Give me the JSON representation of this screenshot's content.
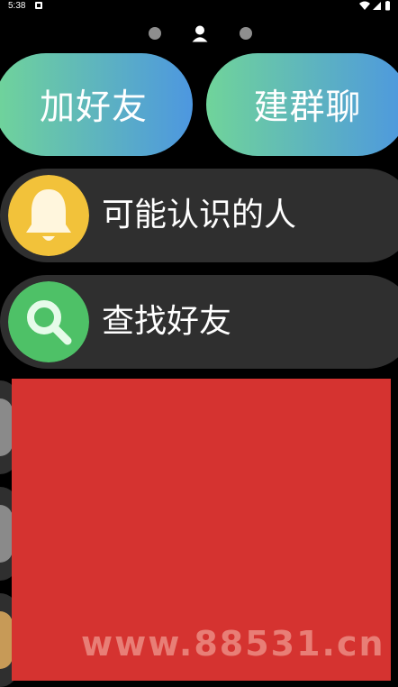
{
  "status_bar": {
    "time": "5:38"
  },
  "actions": {
    "add_friend_label": "加好友",
    "create_group_label": "建群聊"
  },
  "list": {
    "items": [
      {
        "label": "可能认识的人",
        "icon": "bell-icon"
      },
      {
        "label": "查找好友",
        "icon": "search-icon"
      }
    ]
  },
  "watermark": "www.88531.cn",
  "colors": {
    "background": "#000000",
    "row_background": "#2f2f2f",
    "gradient_start": "#70d49a",
    "gradient_end": "#4d97e0",
    "bell_icon_bg": "#f2c23a",
    "search_icon_bg": "#4ec167",
    "redaction": "#d53330"
  }
}
